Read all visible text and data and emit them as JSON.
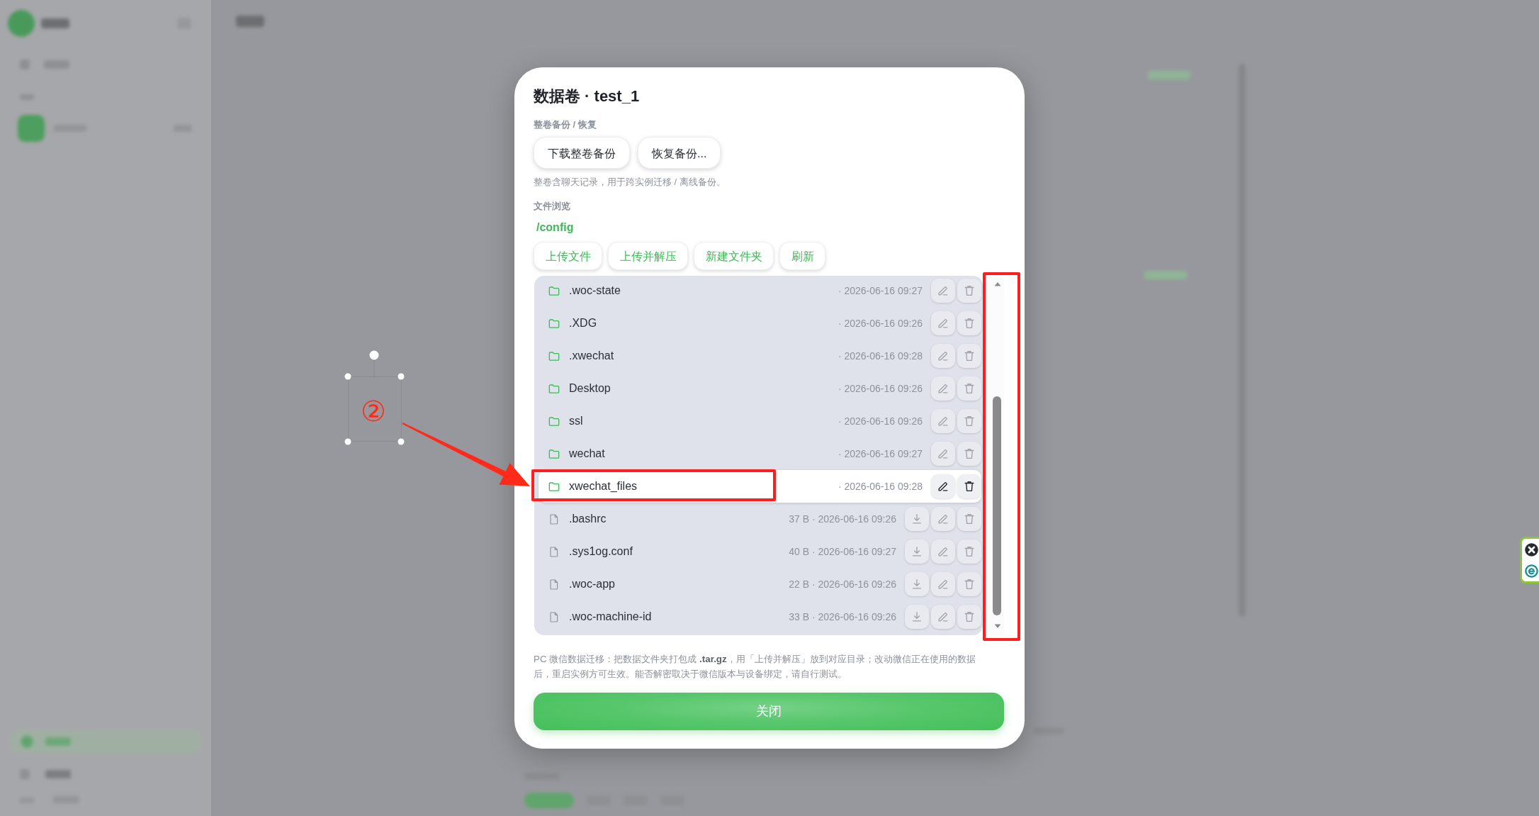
{
  "dialog": {
    "title": "数据卷 · test_1",
    "backup": {
      "label": "整卷备份 / 恢复",
      "buttons": [
        "下载整卷备份",
        "恢复备份..."
      ],
      "hint": "整卷含聊天记录，用于跨实例迁移 / 离线备份。"
    },
    "browser": {
      "label": "文件浏览",
      "path": "/config",
      "actions": [
        "上传文件",
        "上传并解压",
        "新建文件夹",
        "刷新"
      ],
      "entries": [
        {
          "kind": "folder",
          "name": ".woc-state",
          "meta": "· 2026-06-16 09:27",
          "selected": false
        },
        {
          "kind": "folder",
          "name": ".XDG",
          "meta": "· 2026-06-16 09:26",
          "selected": false
        },
        {
          "kind": "folder",
          "name": ".xwechat",
          "meta": "· 2026-06-16 09:28",
          "selected": false
        },
        {
          "kind": "folder",
          "name": "Desktop",
          "meta": "· 2026-06-16 09:26",
          "selected": false
        },
        {
          "kind": "folder",
          "name": "ssl",
          "meta": "· 2026-06-16 09:26",
          "selected": false
        },
        {
          "kind": "folder",
          "name": "wechat",
          "meta": "· 2026-06-16 09:27",
          "selected": false
        },
        {
          "kind": "folder",
          "name": "xwechat_files",
          "meta": "· 2026-06-16 09:28",
          "selected": true
        },
        {
          "kind": "file",
          "name": ".bashrc",
          "meta": "37 B · 2026-06-16 09:26",
          "selected": false
        },
        {
          "kind": "file",
          "name": ".sys1og.conf",
          "meta": "40 B · 2026-06-16 09:27",
          "selected": false
        },
        {
          "kind": "file",
          "name": ".woc-app",
          "meta": "22 B · 2026-06-16 09:26",
          "selected": false
        },
        {
          "kind": "file",
          "name": ".woc-machine-id",
          "meta": "33 B · 2026-06-16 09:26",
          "selected": false
        }
      ]
    },
    "note": "PC 微信数据迁移：把数据文件夹打包成 **.tar.gz**，用「上传并解压」放到对应目录；改动微信正在使用的数据后，重启实例方可生效。能否解密取决于微信版本与设备绑定，请自行测试。",
    "close_button": "关闭"
  },
  "annotation": {
    "step_label": "②"
  }
}
